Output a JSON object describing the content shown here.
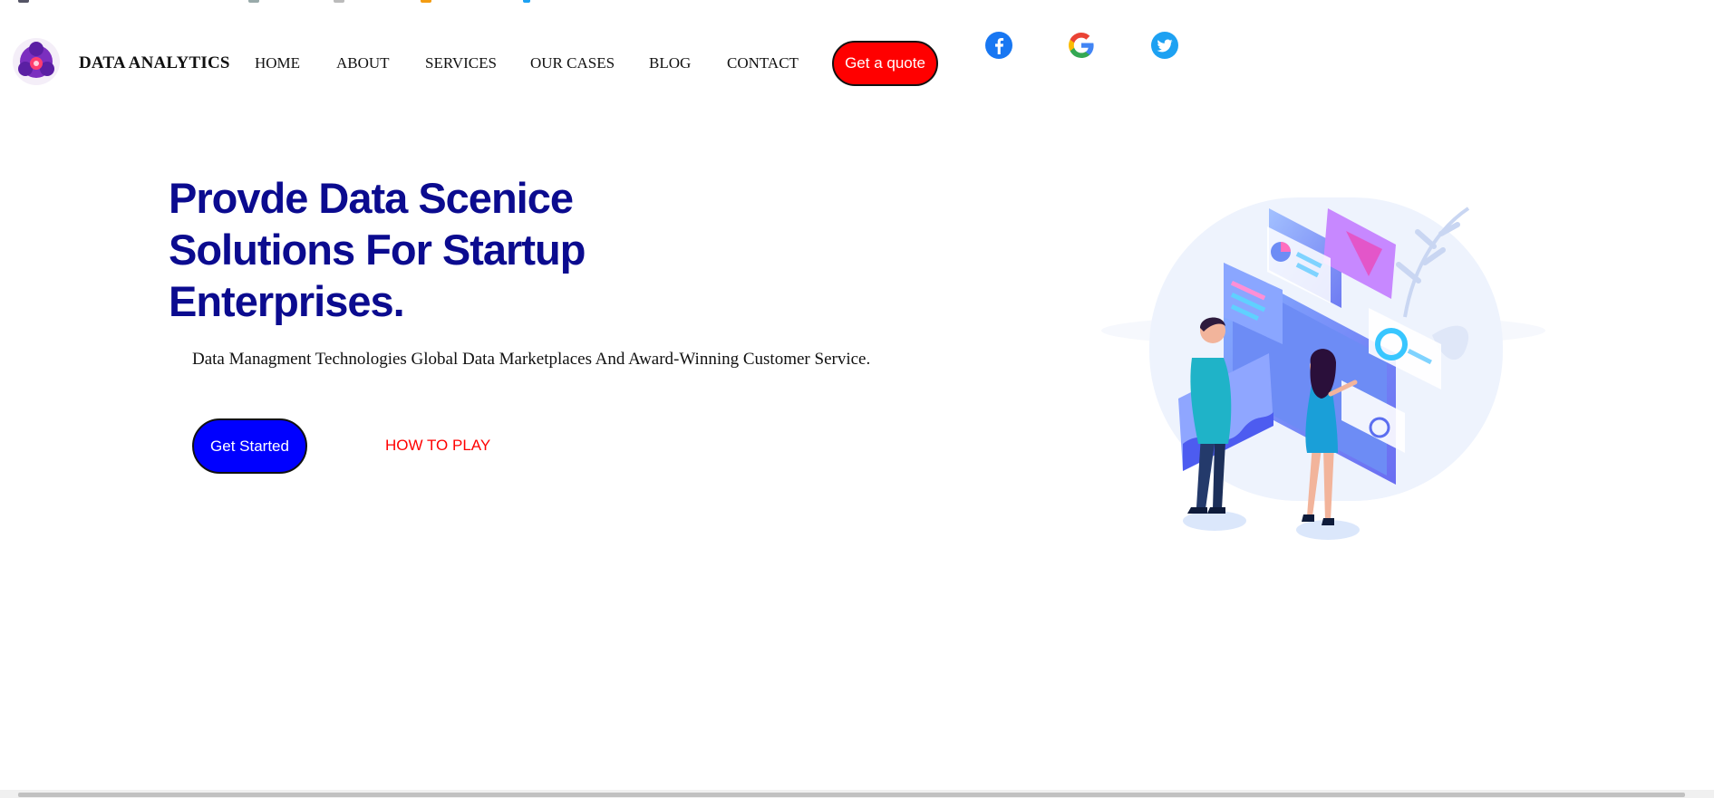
{
  "header": {
    "brand": "DATA ANALYTICS",
    "nav": [
      "HOME",
      "ABOUT",
      "SERVICES",
      "OUR CASES",
      "BLOG",
      "CONTACT"
    ],
    "quote_button": "Get a quote",
    "social_icons": [
      "facebook-icon",
      "google-icon",
      "twitter-icon"
    ]
  },
  "hero": {
    "title": "Provde Data Scenice Solutions For Startup Enterprises.",
    "subtitle": "Data Managment Technologies Global Data Marketplaces And Award-Winning Customer Service.",
    "start_button": "Get Started",
    "play_link": "HOW TO PLAY"
  },
  "colors": {
    "title": "#0b0b8f",
    "quote_button": "#ff0000",
    "start_button": "#0000ff",
    "play_link": "#ff0000",
    "social": "#1da1f2"
  }
}
